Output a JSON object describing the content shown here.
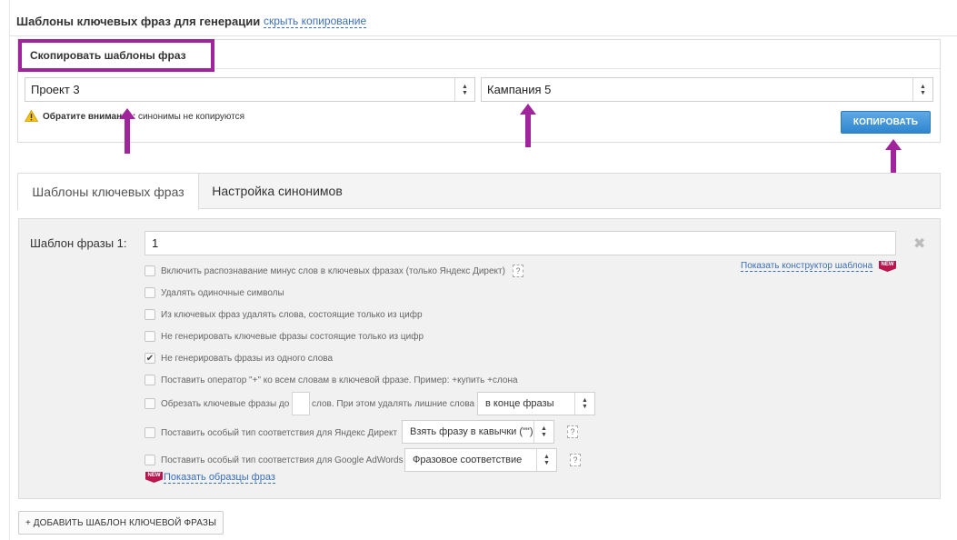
{
  "header": {
    "title": "Шаблоны ключевых фраз для генерации",
    "hide_copy_link": "скрыть копирование"
  },
  "copy_panel": {
    "title": "Скопировать шаблоны фраз",
    "project_select": {
      "value": "Проект 3"
    },
    "campaign_select": {
      "value": "Кампания 5"
    },
    "warning_label": "Обратите внимание:",
    "warning_text": "синонимы не копируются",
    "copy_button": "КОПИРОВАТЬ"
  },
  "tabs": [
    {
      "label": "Шаблоны ключевых фраз",
      "active": true
    },
    {
      "label": "Настройка синонимов",
      "active": false
    }
  ],
  "template": {
    "label": "Шаблон фразы 1:",
    "value": "1",
    "constructor_link": "Показать конструктор шаблона",
    "new_badge": "NEW",
    "options": [
      {
        "label": "Включить распознавание минус слов в ключевых фразах (только Яндекс Директ)",
        "checked": false,
        "help": "?"
      },
      {
        "label": "Удалять одиночные символы",
        "checked": false
      },
      {
        "label": "Из ключевых фраз удалять слова, состоящие только из цифр",
        "checked": false
      },
      {
        "label": "Не генерировать ключевые фразы состоящие только из цифр",
        "checked": false
      },
      {
        "label": "Не генерировать фразы из одного слова",
        "checked": true
      },
      {
        "label": "Поставить оператор \"+\" ко всем словам в ключевой фразе. Пример: +купить +слона",
        "checked": false
      }
    ],
    "trim_option": {
      "label_before": "Обрезать ключевые фразы до",
      "label_after": "слов. При этом удалять лишние слова",
      "select_value": "в конце фразы",
      "checked": false
    },
    "yandex_option": {
      "label": "Поставить особый тип соответствия для Яндекс Директ",
      "select_value": "Взять фразу в кавычки (\"\")",
      "help": "?",
      "checked": false
    },
    "google_option": {
      "label": "Поставить особый тип соответствия для Google AdWords",
      "select_value": "Фразовое соответствие",
      "help": "?",
      "checked": false
    },
    "samples_link": "Показать образцы фраз"
  },
  "add_button": "+ ДОБАВИТЬ ШАБЛОН КЛЮЧЕВОЙ ФРАЗЫ",
  "colors": {
    "accent_link": "#3b6fb6",
    "highlight_border": "#a0249c",
    "annotation_arrow": "#a0249c",
    "copy_button": "#3a8fd6",
    "new_badge": "#b8174f"
  }
}
